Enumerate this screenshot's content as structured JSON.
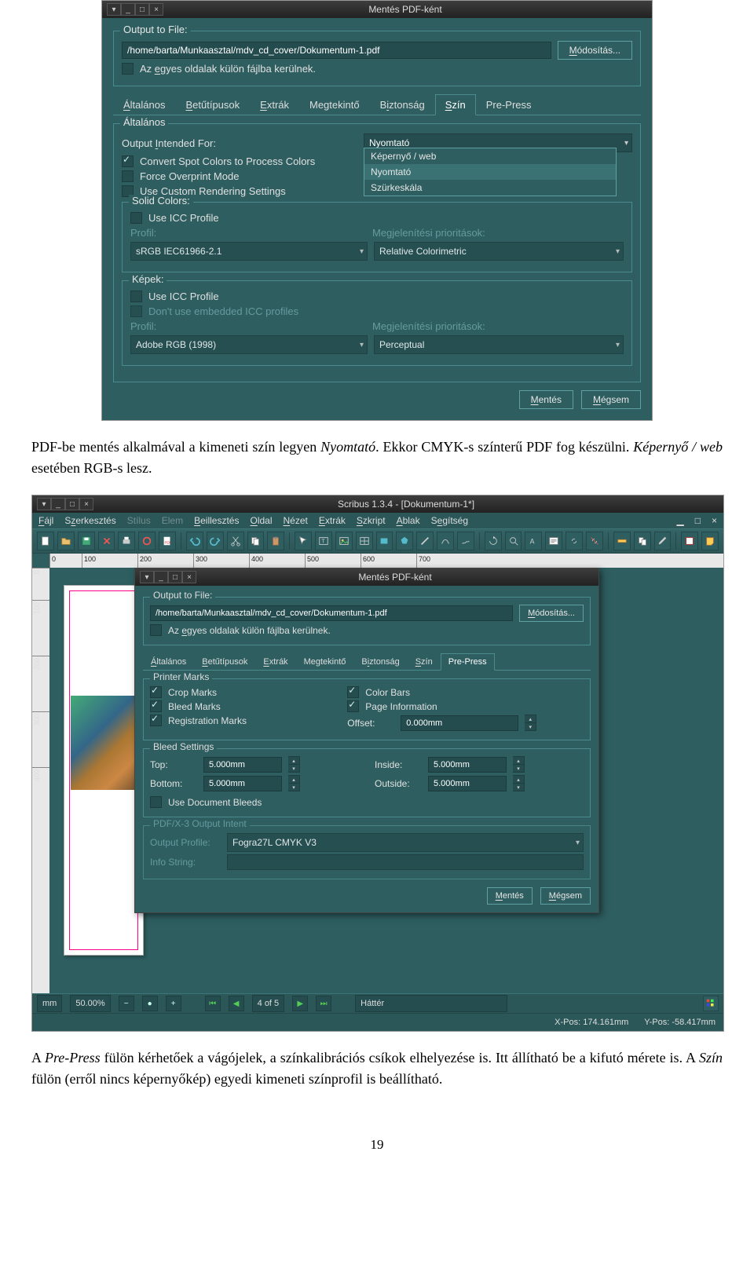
{
  "dialog1": {
    "title": "Mentés PDF-ként",
    "output_legend": "Output to File:",
    "path": "/home/barta/Munkaasztal/mdv_cd_cover/Dokumentum-1.pdf",
    "modify_btn": "Módosítás...",
    "separate_pages": "Az egyes oldalak külön fájlba kerülnek.",
    "tabs": [
      "Általános",
      "Betűtípusok",
      "Extrák",
      "Megtekintő",
      "Biztonság",
      "Szín",
      "Pre-Press"
    ],
    "active_tab_index": 5,
    "general_legend": "Általános",
    "output_intended": "Output Intended For:",
    "output_value": "Nyomtató",
    "dropdown": [
      "Képernyő / web",
      "Nyomtató",
      "Szürkeskála"
    ],
    "dropdown_sel": 1,
    "convert_spot": "Convert Spot Colors to Process Colors",
    "force_overprint": "Force Overprint Mode",
    "use_custom": "Use Custom Rendering Settings",
    "solid_legend": "Solid Colors:",
    "use_icc": "Use ICC Profile",
    "profil": "Profil:",
    "render_intent": "Megjelenítési prioritások:",
    "srgb": "sRGB IEC61966-2.1",
    "rel_color": "Relative Colorimetric",
    "images_legend": "Képek:",
    "dont_embed": "Don't use embedded ICC profiles",
    "adobe_rgb": "Adobe RGB (1998)",
    "perceptual": "Perceptual",
    "save_btn": "Mentés",
    "cancel_btn": "Mégsem"
  },
  "para1_a": "PDF-be mentés alkalmával a kimeneti szín legyen ",
  "para1_b": "Nyomtató",
  "para1_c": ". Ekkor CMYK-s színterű PDF fog készülni. ",
  "para1_d": "Képernyő / web",
  "para1_e": " esetében RGB-s lesz.",
  "scribus": {
    "title": "Scribus 1.3.4 - [Dokumentum-1*]",
    "menu": [
      "Fájl",
      "Szerkesztés",
      "Stílus",
      "Elem",
      "Beillesztés",
      "Oldal",
      "Nézet",
      "Extrák",
      "Szkript",
      "Ablak",
      "Segítség"
    ],
    "menu_dim": [
      2,
      3
    ],
    "status_unit": "mm",
    "zoom": "50.00%",
    "pages": "4 of 5",
    "layer": "Háttér",
    "xpos": "X-Pos: 174.161mm",
    "ypos": "Y-Pos: -58.417mm",
    "ruler_h": [
      "0",
      "100",
      "200",
      "300",
      "400",
      "500",
      "600",
      "700"
    ],
    "ruler_v": [
      "0",
      "100",
      "200",
      "300",
      "400"
    ]
  },
  "dialog2": {
    "title": "Mentés PDF-ként",
    "output_legend": "Output to File:",
    "path": "/home/barta/Munkaasztal/mdv_cd_cover/Dokumentum-1.pdf",
    "modify_btn": "Módosítás...",
    "separate_pages": "Az egyes oldalak külön fájlba kerülnek.",
    "tabs": [
      "Általános",
      "Betűtípusok",
      "Extrák",
      "Megtekintő",
      "Biztonság",
      "Szín",
      "Pre-Press"
    ],
    "active_tab_index": 6,
    "marks_legend": "Printer Marks",
    "crop": "Crop Marks",
    "bleed_marks": "Bleed Marks",
    "reg_marks": "Registration Marks",
    "color_bars": "Color Bars",
    "page_info": "Page Information",
    "offset_lbl": "Offset:",
    "offset_val": "0.000mm",
    "bleed_legend": "Bleed Settings",
    "top_lbl": "Top:",
    "bottom_lbl": "Bottom:",
    "inside_lbl": "Inside:",
    "outside_lbl": "Outside:",
    "bleed_val": "5.000mm",
    "use_doc_bleeds": "Use Document Bleeds",
    "pdfx_legend": "PDF/X-3 Output Intent",
    "out_profile": "Output Profile:",
    "out_profile_val": "Fogra27L CMYK V3",
    "info_string": "Info String:",
    "save_btn": "Mentés",
    "cancel_btn": "Mégsem"
  },
  "para2_a": "A ",
  "para2_b": "Pre-Press",
  "para2_c": " fülön kérhetőek a vágójelek, a színkalibrációs csíkok elhelyezése is. Itt állítható be a kifutó mérete is. A ",
  "para2_d": "Szín",
  "para2_e": " fülön (erről nincs képernyőkép) egyedi kimeneti színprofil is beállítható.",
  "pagenum": "19"
}
